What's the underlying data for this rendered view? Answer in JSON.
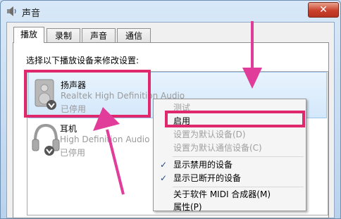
{
  "window": {
    "title": "声音",
    "close_label": "✕"
  },
  "tabs": [
    {
      "label": "播放"
    },
    {
      "label": "录制"
    },
    {
      "label": "声音"
    },
    {
      "label": "通信"
    }
  ],
  "panel": {
    "instruction": "选择以下播放设备来修改设置:"
  },
  "devices": [
    {
      "name": "扬声器",
      "driver": "Realtek High Definition Audio",
      "status": "已停用",
      "icon": "speaker-icon"
    },
    {
      "name": "耳机",
      "driver": "High Definition Audio",
      "status": "已停用",
      "icon": "headphones-icon"
    }
  ],
  "context_menu": {
    "items": [
      {
        "label": "测试",
        "disabled": true
      },
      {
        "label": "启用",
        "disabled": false
      },
      {
        "label": "设置为默认设备(D)",
        "disabled": true
      },
      {
        "label": "设置为默认通信设备(C)",
        "disabled": true
      },
      {
        "label": "显示禁用的设备",
        "checked": true
      },
      {
        "label": "显示已断开的设备",
        "checked": true
      },
      {
        "label": "关于软件 MIDI 合成器(M)",
        "disabled": false
      },
      {
        "label": "属性(P)",
        "disabled": false
      }
    ]
  },
  "annotation_color": "#e0296d",
  "arrow_color": "#e23c9a"
}
